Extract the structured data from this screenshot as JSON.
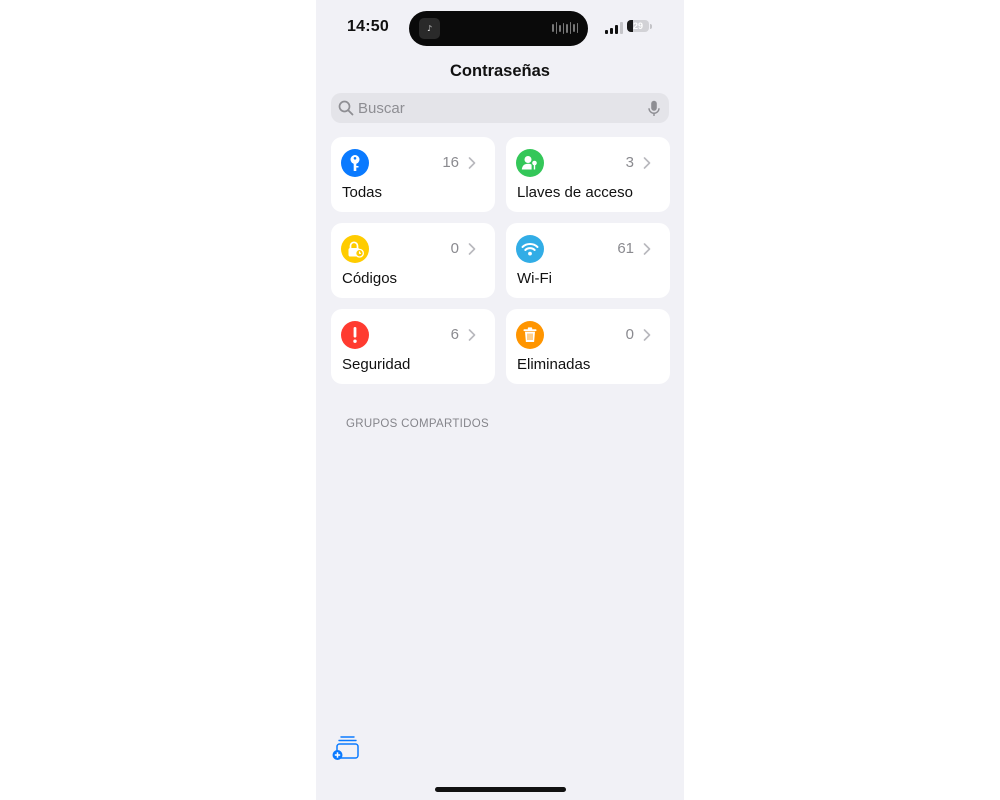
{
  "status_bar": {
    "time": "14:50",
    "battery_level": "29",
    "battery_fraction": 0.29,
    "signal_bars": 3
  },
  "header": {
    "title": "Contraseñas"
  },
  "search": {
    "placeholder": "Buscar",
    "value": ""
  },
  "categories": [
    {
      "label": "Todas",
      "count": "16",
      "icon": "key-icon",
      "color": "#0a7aff"
    },
    {
      "label": "Llaves de acceso",
      "count": "3",
      "icon": "person-key-icon",
      "color": "#34c759"
    },
    {
      "label": "Códigos",
      "count": "0",
      "icon": "lock-clock-icon",
      "color": "#ffcc00"
    },
    {
      "label": "Wi-Fi",
      "count": "61",
      "icon": "wifi-icon",
      "color": "#32ade6"
    },
    {
      "label": "Seguridad",
      "count": "6",
      "icon": "exclamation-icon",
      "color": "#ff3b30"
    },
    {
      "label": "Eliminadas",
      "count": "0",
      "icon": "trash-icon",
      "color": "#ff9500"
    }
  ],
  "shared_groups": {
    "header": "GRUPOS COMPARTIDOS"
  },
  "toolbar": {
    "new_group_icon": "new-group-icon",
    "accent": "#0a7aff"
  }
}
